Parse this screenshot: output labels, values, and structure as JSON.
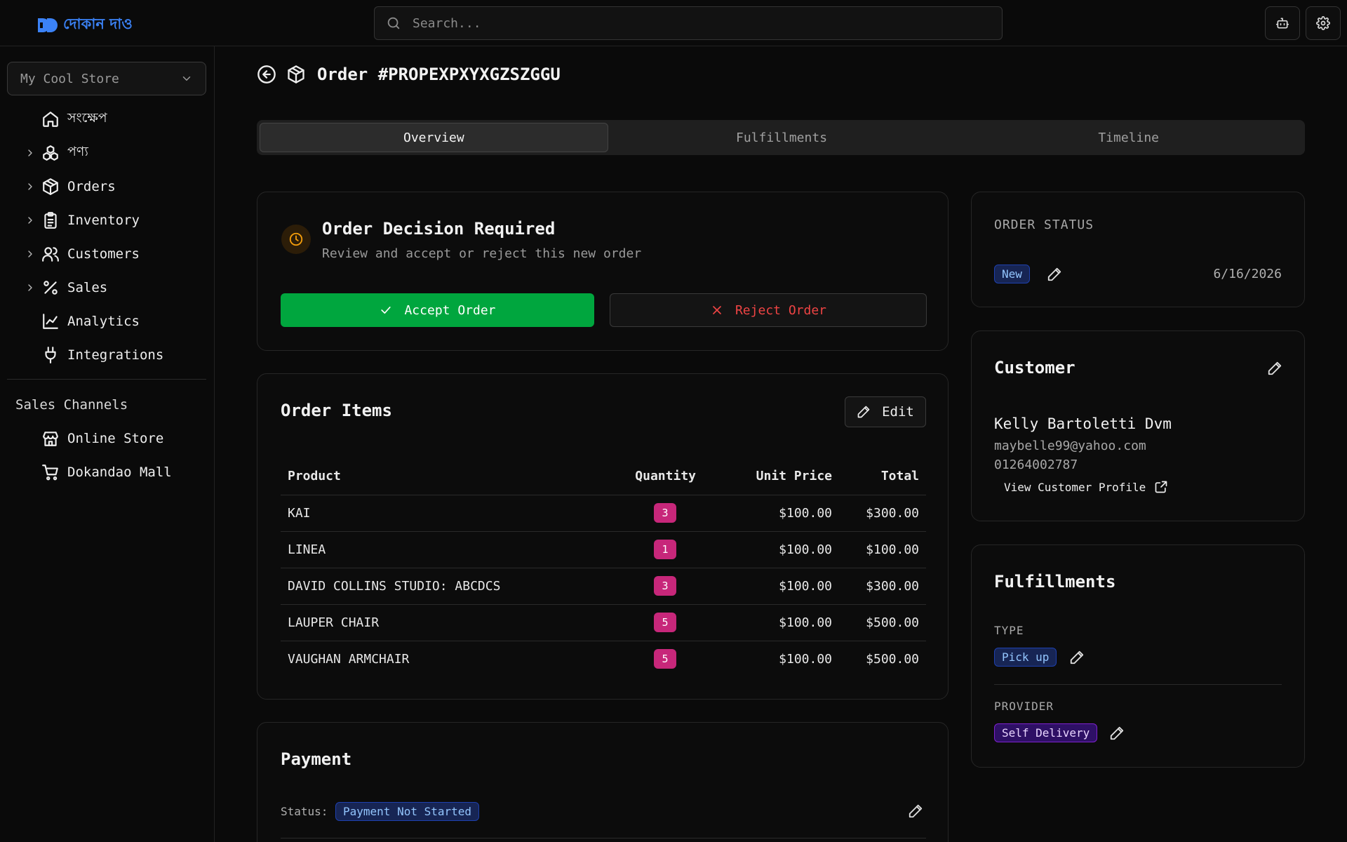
{
  "app": {
    "logo_text": "দোকান দাও",
    "brand_color": "#3b82f6"
  },
  "search": {
    "placeholder": "Search..."
  },
  "topbar": {
    "icons": [
      "bot-icon",
      "gear-icon"
    ]
  },
  "sidebar": {
    "store": "My Cool Store",
    "items": [
      {
        "label": "সংক্ষেপ",
        "icon": "home-icon",
        "expandable": false
      },
      {
        "label": "পণ্য",
        "icon": "boxes-icon",
        "expandable": true
      },
      {
        "label": "Orders",
        "icon": "package-icon",
        "expandable": true
      },
      {
        "label": "Inventory",
        "icon": "clipboard-icon",
        "expandable": true
      },
      {
        "label": "Customers",
        "icon": "users-icon",
        "expandable": true
      },
      {
        "label": "Sales",
        "icon": "percent-icon",
        "expandable": true
      },
      {
        "label": "Analytics",
        "icon": "chart-line-icon",
        "expandable": false
      },
      {
        "label": "Integrations",
        "icon": "plug-icon",
        "expandable": false
      }
    ],
    "channels_heading": "Sales Channels",
    "channels": [
      {
        "label": "Online Store",
        "icon": "store-icon"
      },
      {
        "label": "Dokandao Mall",
        "icon": "cart-icon"
      }
    ]
  },
  "page": {
    "title": "Order #PROPEXPXYXGZSZGGU"
  },
  "tabs": [
    {
      "label": "Overview",
      "active": true
    },
    {
      "label": "Fulfillments",
      "active": false
    },
    {
      "label": "Timeline",
      "active": false
    }
  ],
  "decision": {
    "title": "Order Decision Required",
    "subtitle": "Review and accept or reject this new order",
    "accept_label": "Accept Order",
    "reject_label": "Reject Order",
    "accept_color": "#00a63e",
    "reject_color": "#ef4444"
  },
  "items": {
    "title": "Order Items",
    "edit_label": "Edit",
    "columns": [
      "Product",
      "Quantity",
      "Unit Price",
      "Total"
    ],
    "rows": [
      {
        "product": "KAI",
        "qty": "3",
        "unit": "$100.00",
        "total": "$300.00"
      },
      {
        "product": "LINEA",
        "qty": "1",
        "unit": "$100.00",
        "total": "$100.00"
      },
      {
        "product": "DAVID COLLINS STUDIO: ABCDCS",
        "qty": "3",
        "unit": "$100.00",
        "total": "$300.00"
      },
      {
        "product": "LAUPER CHAIR",
        "qty": "5",
        "unit": "$100.00",
        "total": "$500.00"
      },
      {
        "product": "VAUGHAN ARMCHAIR",
        "qty": "5",
        "unit": "$100.00",
        "total": "$500.00"
      }
    ]
  },
  "payment": {
    "title": "Payment",
    "status_label": "Status:",
    "status_value": "Payment Not Started"
  },
  "order_status": {
    "heading": "ORDER STATUS",
    "status": "New",
    "date": "6/16/2026"
  },
  "customer": {
    "heading": "Customer",
    "name": "Kelly Bartoletti Dvm",
    "email": "maybelle99@yahoo.com",
    "phone": "01264002787",
    "profile_link": "View Customer Profile"
  },
  "fulfillments": {
    "heading": "Fulfillments",
    "type_label": "TYPE",
    "type_value": "Pick up",
    "provider_label": "PROVIDER",
    "provider_value": "Self Delivery"
  }
}
